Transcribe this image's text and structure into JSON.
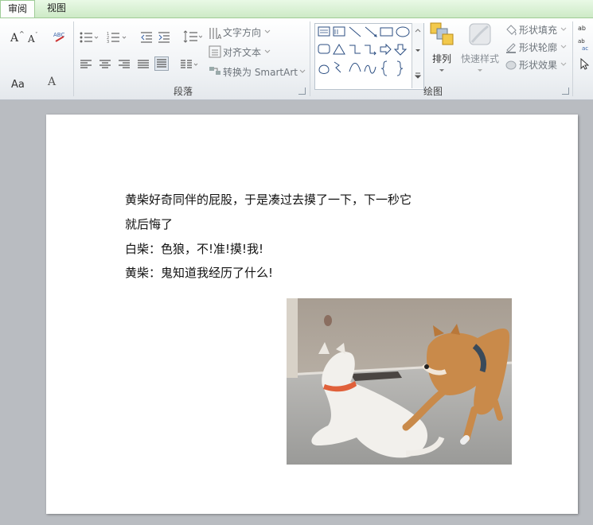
{
  "tabs": [
    {
      "label": "审阅",
      "active": true
    },
    {
      "label": "视图",
      "active": false
    }
  ],
  "ribbon": {
    "paragraph_group": {
      "label": "段落",
      "text_direction": "文字方向",
      "align_text": "对齐文本",
      "convert_smartart": "转换为 SmartArt"
    },
    "drawing_group": {
      "label": "绘图",
      "arrange": "排列",
      "quick_styles": "快速样式",
      "shape_fill": "形状填充",
      "shape_outline": "形状轮廓",
      "shape_effects": "形状效果"
    },
    "font_group": {
      "font_size_label": "Aa"
    }
  },
  "document": {
    "lines": [
      "黄柴好奇同伴的屁股，于是凑过去摸了一下，下一秒它",
      "就后悔了",
      "白柴：色狼，不!准!摸!我!",
      "黄柴：鬼知道我经历了什么!"
    ]
  },
  "colors": {
    "tab_bar": "#cdeac6",
    "workspace": "#b9bcc1",
    "page": "#ffffff",
    "shiba_tan": "#c98a4a",
    "white_dog": "#f2f0ec",
    "collar": "#e0603a"
  }
}
